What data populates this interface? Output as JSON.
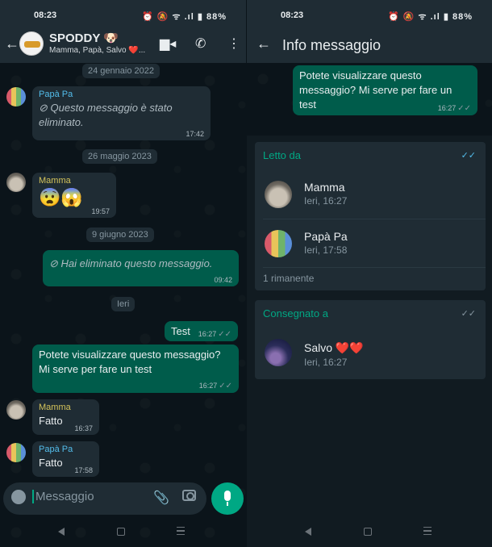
{
  "status": {
    "time": "08:23",
    "battery": "88%",
    "icons": "⏰ 🔕 ᯤ .ıl ▮"
  },
  "chat": {
    "group_name": "SPODDY 🐶",
    "members": "Mamma, Papà, Salvo ❤️...",
    "dates": [
      "24 gennaio 2022",
      "26 maggio 2023",
      "9 giugno 2023",
      "Ieri"
    ],
    "messages": [
      {
        "sender": "Papà Pa",
        "text": "Questo messaggio è stato eliminato.",
        "time": "17:42"
      },
      {
        "sender": "Mamma",
        "text": "😨😱",
        "time": "19:57"
      },
      {
        "text": "Hai eliminato questo messaggio.",
        "time": "09:42"
      },
      {
        "text": "Test",
        "time": "16:27"
      },
      {
        "text": "Potete visualizzare questo messaggio? Mi serve per fare un test",
        "time": "16:27"
      },
      {
        "sender": "Mamma",
        "text": "Fatto",
        "time": "16:37"
      },
      {
        "sender": "Papà Pa",
        "text": "Fatto",
        "time": "17:58"
      }
    ],
    "input_placeholder": "Messaggio"
  },
  "info": {
    "title": "Info messaggio",
    "message": {
      "text": "Potete visualizzare questo messaggio? Mi serve per fare un test",
      "time": "16:27"
    },
    "read_by": {
      "label": "Letto da",
      "rows": [
        {
          "name": "Mamma",
          "time": "Ieri, 16:27"
        },
        {
          "name": "Papà Pa",
          "time": "Ieri, 17:58"
        }
      ],
      "remaining": "1 rimanente"
    },
    "delivered_to": {
      "label": "Consegnato a",
      "rows": [
        {
          "name": "Salvo ❤️❤️",
          "time": "Ieri, 16:27"
        }
      ]
    }
  },
  "colors": {
    "accent": "#00a884",
    "outgoing": "#005c4b",
    "incoming": "#1f2c34",
    "read_tick": "#53bdeb",
    "mamma_name": "#d4c35a",
    "papa_name": "#53bdeb"
  }
}
